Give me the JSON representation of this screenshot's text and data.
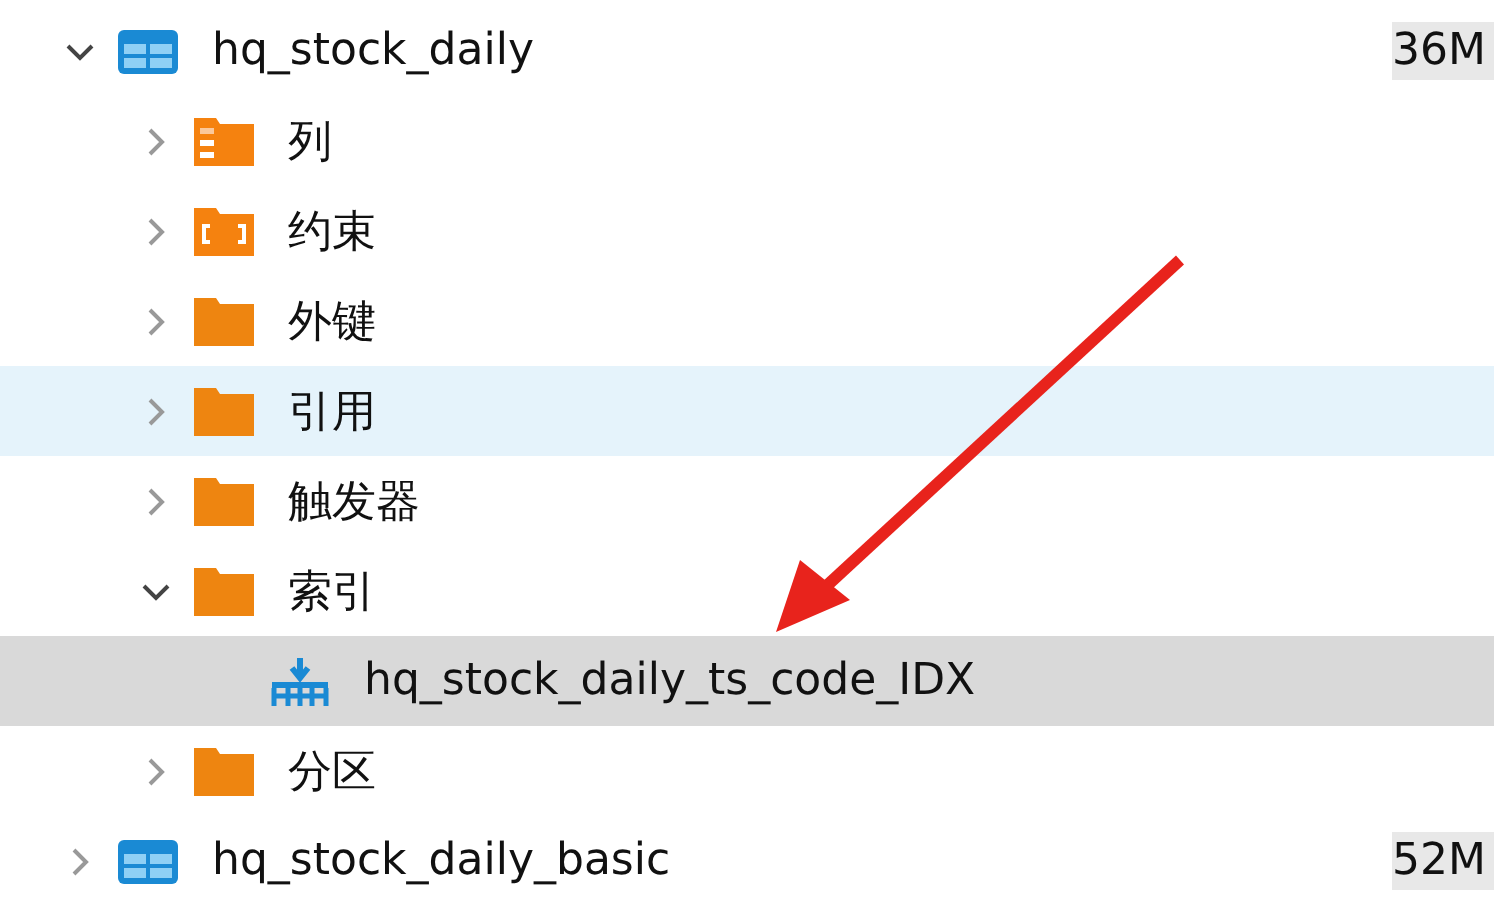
{
  "tree": [
    {
      "name": "hq_stock_daily",
      "kind": "table",
      "size": "36M",
      "expanded": true,
      "selected": false,
      "hovered": false,
      "children": [
        {
          "name": "列",
          "kind": "columns",
          "expanded": false,
          "selected": false,
          "hovered": false
        },
        {
          "name": "约束",
          "kind": "constraints",
          "expanded": false,
          "selected": false,
          "hovered": false
        },
        {
          "name": "外键",
          "kind": "folder",
          "expanded": false,
          "selected": false,
          "hovered": false
        },
        {
          "name": "引用",
          "kind": "folder",
          "expanded": false,
          "selected": false,
          "hovered": true
        },
        {
          "name": "触发器",
          "kind": "folder",
          "expanded": false,
          "selected": false,
          "hovered": false
        },
        {
          "name": "索引",
          "kind": "folder",
          "expanded": true,
          "selected": false,
          "hovered": false,
          "children": [
            {
              "name": "hq_stock_daily_ts_code_IDX",
              "kind": "index",
              "selected": true,
              "hovered": false
            }
          ]
        },
        {
          "name": "分区",
          "kind": "folder",
          "expanded": false,
          "selected": false,
          "hovered": false
        }
      ]
    },
    {
      "name": "hq_stock_daily_basic",
      "kind": "table",
      "size": "52M",
      "expanded": false,
      "selected": false,
      "hovered": false
    }
  ]
}
